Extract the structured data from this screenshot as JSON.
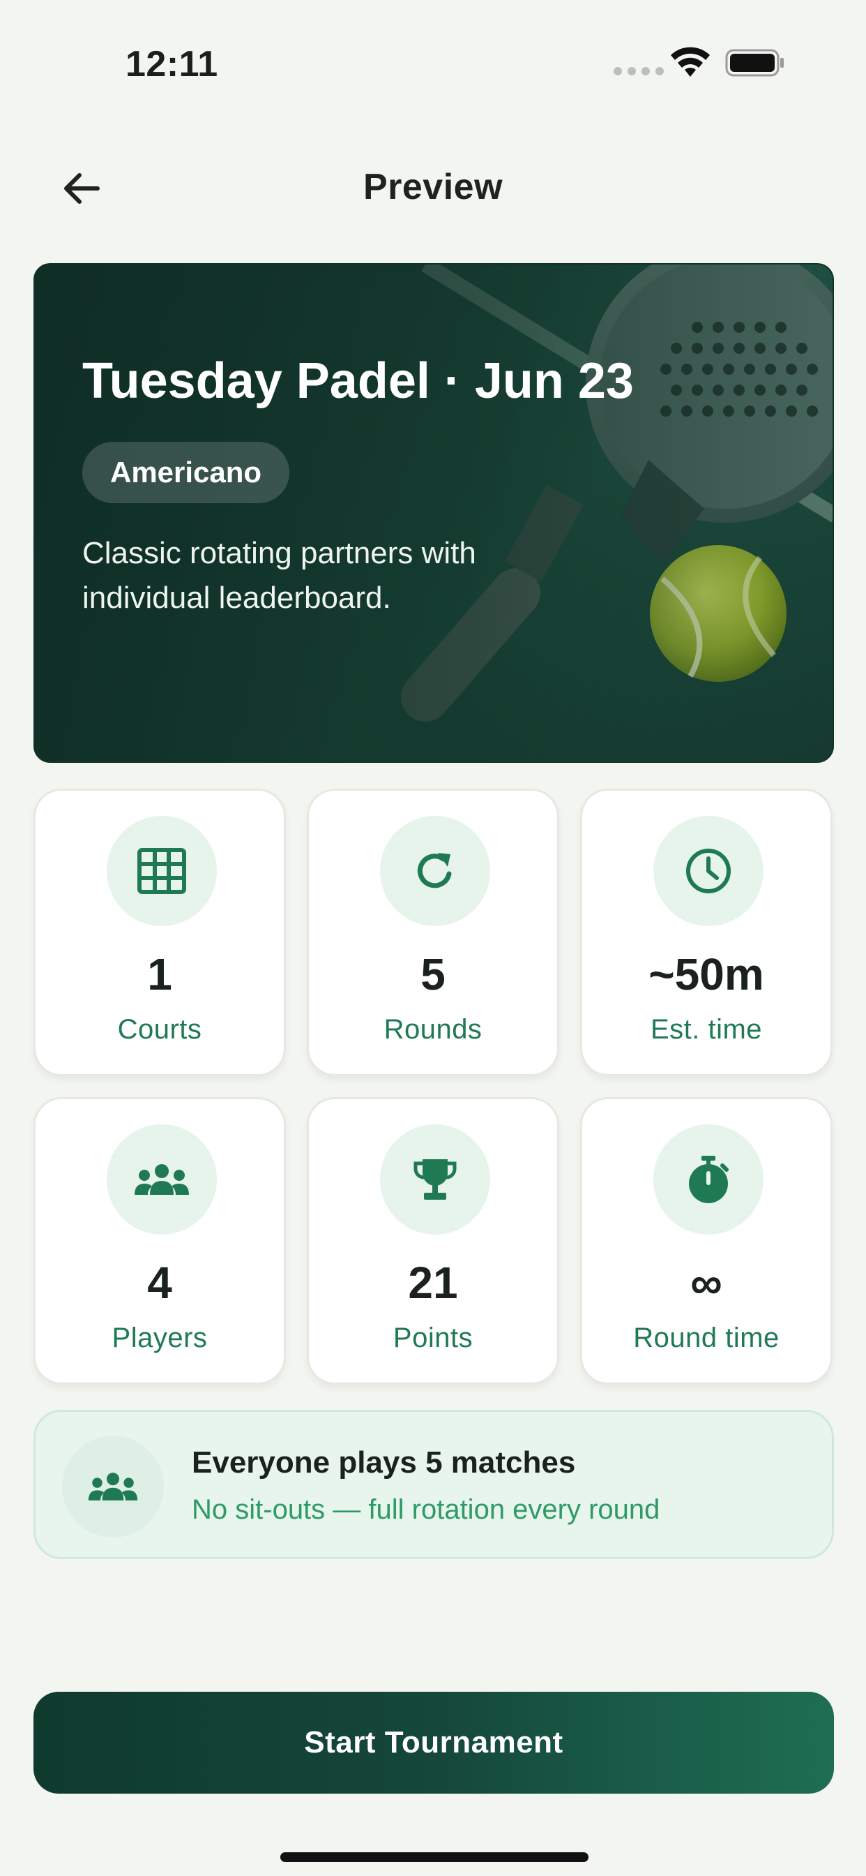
{
  "status_bar": {
    "time": "12:11"
  },
  "header": {
    "title": "Preview",
    "back_icon": "arrow-left-icon"
  },
  "hero": {
    "title": "Tuesday Padel · Jun 23",
    "badge": "Americano",
    "description": "Classic rotating partners with individual leaderboard."
  },
  "stats": [
    {
      "value": "1",
      "label": "Courts",
      "icon": "grid-icon"
    },
    {
      "value": "5",
      "label": "Rounds",
      "icon": "refresh-icon"
    },
    {
      "value": "~50m",
      "label": "Est. time",
      "icon": "clock-icon"
    },
    {
      "value": "4",
      "label": "Players",
      "icon": "group-icon"
    },
    {
      "value": "21",
      "label": "Points",
      "icon": "trophy-icon"
    },
    {
      "value": "∞",
      "label": "Round time",
      "icon": "stopwatch-icon"
    }
  ],
  "info": {
    "title": "Everyone plays 5 matches",
    "subtitle": "No sit-outs — full rotation every round",
    "icon": "group-icon"
  },
  "actions": {
    "start_label": "Start Tournament"
  },
  "colors": {
    "brand_dark": "#0f3a2e",
    "accent_green": "#1f7a54",
    "icon_bg": "#e6f4ec",
    "background": "#f3f5f1"
  }
}
